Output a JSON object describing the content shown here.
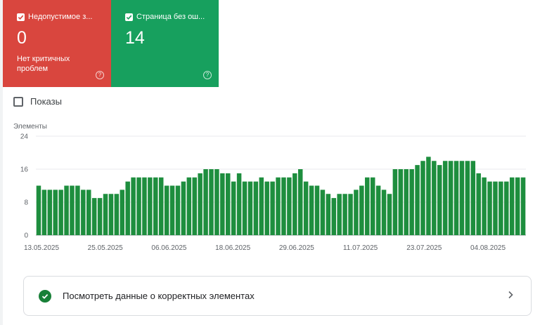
{
  "cards": [
    {
      "title": "Недопустимое з...",
      "value": "0",
      "subtitle": "Нет критичных проблем",
      "color": "#d9463e",
      "help_icon": "help-circle-icon"
    },
    {
      "title": "Страница без ош...",
      "value": "14",
      "subtitle": "",
      "color": "#17a05e",
      "help_icon": "help-circle-icon"
    }
  ],
  "impressions": {
    "label": "Показы",
    "checked": false
  },
  "chart_data": {
    "type": "bar",
    "ylabel": "Элементы",
    "ylim": [
      0,
      24
    ],
    "yticks": [
      "0",
      "8",
      "16",
      "24"
    ],
    "color": "#1e8e3e",
    "grid": true,
    "xtick_labels": [
      "13.05.2025",
      "25.05.2025",
      "06.06.2025",
      "18.06.2025",
      "29.06.2025",
      "11.07.2025",
      "23.07.2025",
      "04.08.2025"
    ],
    "values": [
      12,
      11,
      11,
      11,
      11,
      12,
      12,
      12,
      11,
      11,
      9,
      9,
      10,
      10,
      10,
      11,
      13,
      14,
      14,
      14,
      14,
      14,
      14,
      12,
      12,
      12,
      13,
      14,
      14,
      15,
      16,
      16,
      16,
      15,
      15,
      13,
      15,
      13,
      13,
      13,
      14,
      13,
      13,
      14,
      14,
      14,
      15,
      16,
      13,
      12,
      12,
      11,
      10,
      9,
      10,
      10,
      10,
      11,
      12,
      14,
      14,
      12,
      11,
      10,
      16,
      16,
      16,
      16,
      17,
      18,
      19,
      18,
      17,
      18,
      18,
      18,
      18,
      18,
      18,
      15,
      14,
      13,
      13,
      13,
      13,
      14,
      14,
      14
    ]
  },
  "cta": {
    "label": "Посмотреть данные о корректных элементах",
    "icon": "check-circle-icon",
    "chevron": "chevron-right-icon"
  }
}
